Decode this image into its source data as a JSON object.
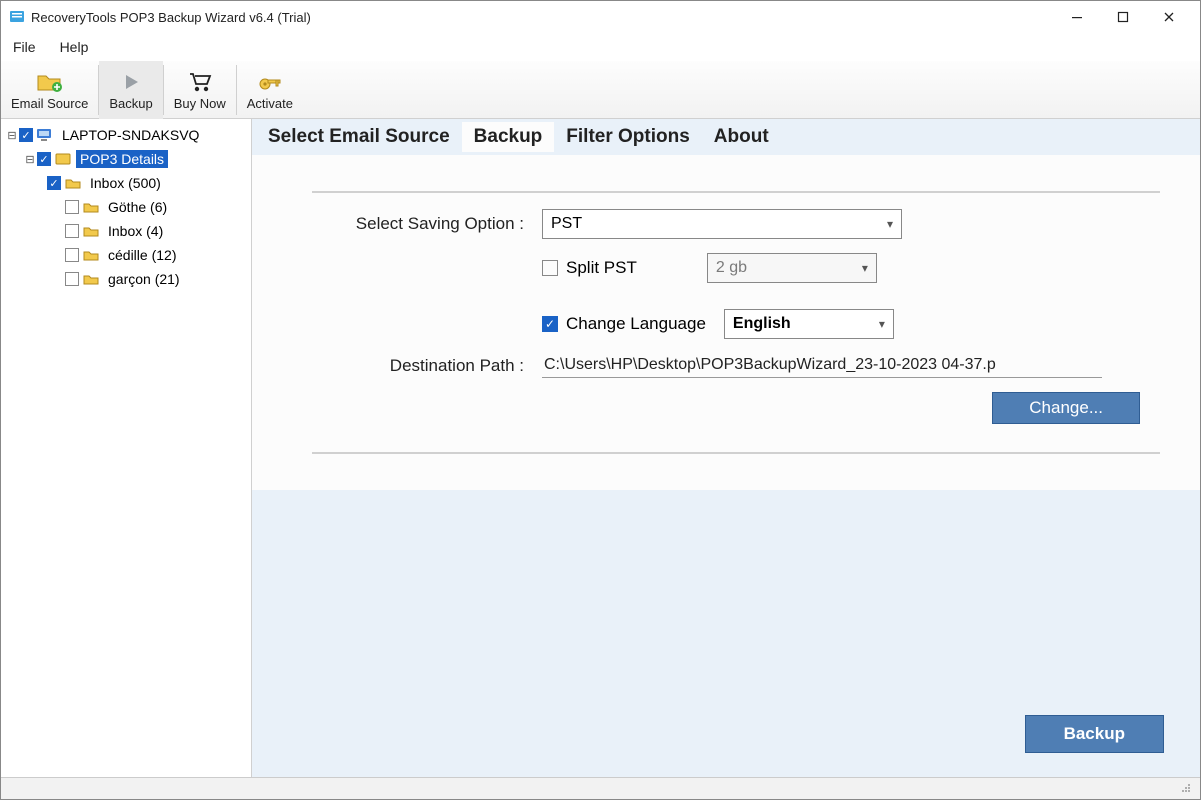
{
  "window": {
    "title": "RecoveryTools POP3 Backup Wizard v6.4 (Trial)"
  },
  "menu": {
    "file": "File",
    "help": "Help"
  },
  "toolbar": {
    "email_source": "Email Source",
    "backup": "Backup",
    "buy_now": "Buy Now",
    "activate": "Activate"
  },
  "tree": {
    "root": "LAPTOP-SNDAKSVQ",
    "pop3": "POP3 Details",
    "items": [
      {
        "label": "Inbox (500)",
        "checked": true
      },
      {
        "label": "Göthe (6)",
        "checked": false
      },
      {
        "label": "Inbox (4)",
        "checked": false
      },
      {
        "label": "cédille (12)",
        "checked": false
      },
      {
        "label": "garçon (21)",
        "checked": false
      }
    ]
  },
  "tabs": {
    "select_source": "Select Email Source",
    "backup": "Backup",
    "filter": "Filter Options",
    "about": "About"
  },
  "form": {
    "saving_option_label": "Select Saving Option :",
    "saving_option_value": "PST",
    "split_pst_label": "Split PST",
    "split_size_value": "2 gb",
    "change_language_label": "Change Language",
    "language_value": "English",
    "destination_label": "Destination Path :",
    "destination_value": "C:\\Users\\HP\\Desktop\\POP3BackupWizard_23-10-2023 04-37.p",
    "change_button": "Change...",
    "backup_button": "Backup"
  }
}
